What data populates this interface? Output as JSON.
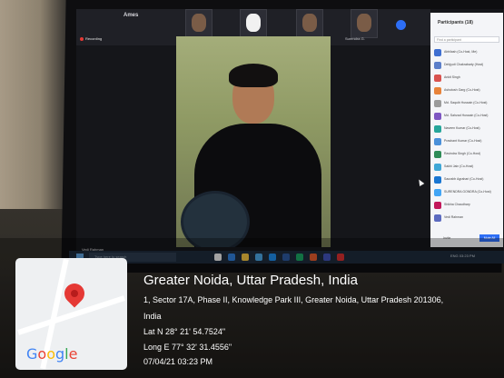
{
  "meeting": {
    "title": "Ames",
    "recording_label": "Recording",
    "speaker_name": "Vedi Rahman"
  },
  "participants_strip": [
    {
      "label": "Shikha Chaudhary"
    },
    {
      "label": "Md Saquib H."
    },
    {
      "label": "Md Sahzad"
    },
    {
      "label": "Surendra G."
    }
  ],
  "participant_panel": {
    "title": "Participants (18)",
    "search_placeholder": "Find a participant",
    "rows": [
      {
        "name": "Abhilash (Co-Host, Me)",
        "color": "#3f6fd1"
      },
      {
        "name": "Debjyoti Chakrabarty (Host)",
        "color": "#5c7fc9"
      },
      {
        "name": "Ankit Singh",
        "color": "#d9534f"
      },
      {
        "name": "Ashutosh Garg (Co-Host)",
        "color": "#e8833a"
      },
      {
        "name": "Md. Saquib Hussain (Co-Host)",
        "color": "#9b9b9b"
      },
      {
        "name": "Md. Sahzad Hussain (Co-Host)",
        "color": "#7e57c2"
      },
      {
        "name": "Naveen Kumar (Co-Host)",
        "color": "#26a69a"
      },
      {
        "name": "Prashant Kumar (Co-Host)",
        "color": "#4a90d9"
      },
      {
        "name": "Ravindra Singh (Co-Host)",
        "color": "#2e8b57"
      },
      {
        "name": "Sakhi Jain (Co-Host)",
        "color": "#3fa7d6"
      },
      {
        "name": "Saurabh Agrahari (Co-Host)",
        "color": "#1976d2"
      },
      {
        "name": "SURENDRA GONDRA (Co-Host)",
        "color": "#42a5f5"
      },
      {
        "name": "Shikha Chaudhary",
        "color": "#c2185b"
      },
      {
        "name": "Vedi Rahman",
        "color": "#5c6bc0"
      }
    ],
    "invite_label": "Invite",
    "mute_all_label": "Mute All"
  },
  "taskbar": {
    "search_placeholder": "Type here to search",
    "tray_text": "ENG 03:23 PM"
  },
  "geotag": {
    "map_brand": "Google",
    "colors": {
      "pin": "#e53935",
      "G": "#4285f4",
      "o1": "#ea4335",
      "o2": "#fbbc05",
      "g": "#4285f4",
      "l": "#34a853",
      "e": "#ea4335"
    },
    "place": "Greater Noida, Uttar Pradesh, India",
    "address": "1, Sector 17A, Phase II, Knowledge Park III, Greater Noida, Uttar Pradesh 201306,",
    "country": "India",
    "latitude": "Lat N 28° 21' 54.7524\"",
    "longitude": "Long E 77° 32' 31.4556\"",
    "timestamp": "07/04/21 03:23 PM"
  }
}
